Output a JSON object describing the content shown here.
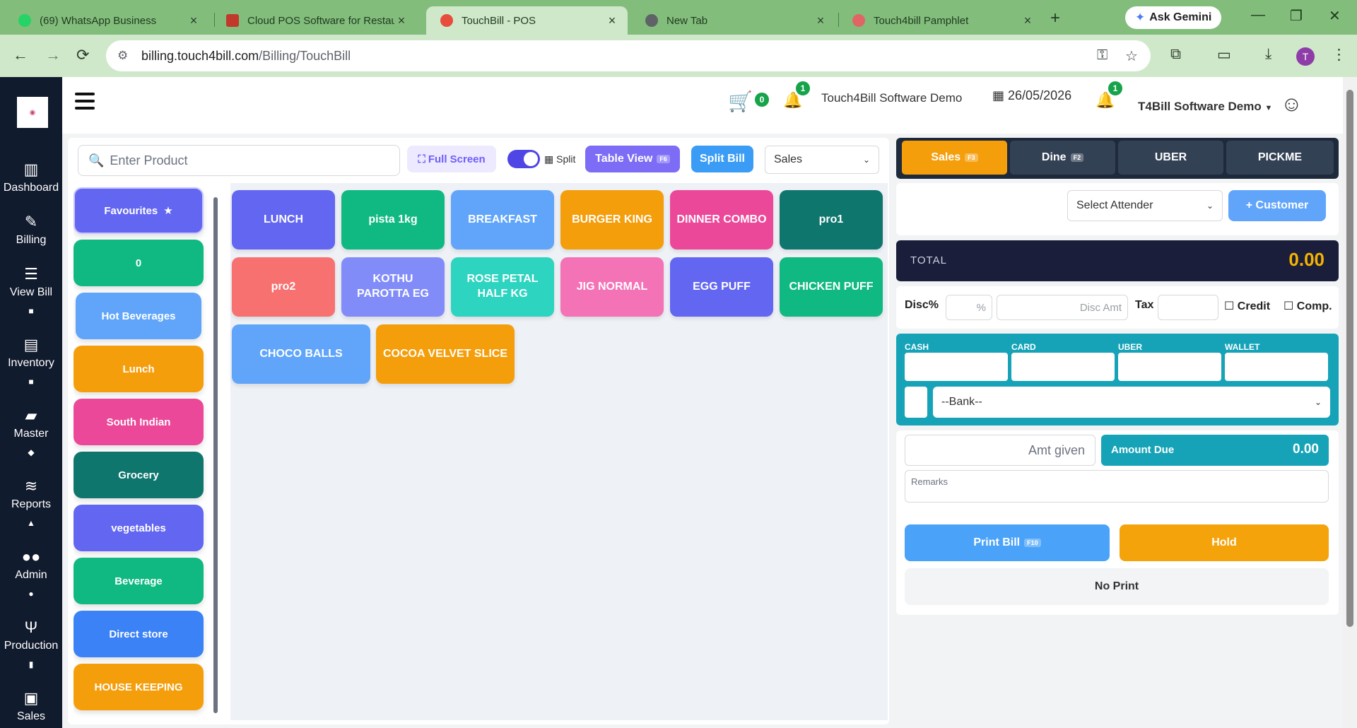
{
  "browser": {
    "tabs": [
      {
        "title": "(69) WhatsApp Business",
        "favicon_color": "#25d366"
      },
      {
        "title": "Cloud POS Software for Restau",
        "favicon_color": "#c0392b"
      },
      {
        "title": "TouchBill - POS",
        "favicon_color": "#e74c3c"
      },
      {
        "title": "New Tab",
        "favicon_color": "#5f6368"
      },
      {
        "title": "Touch4bill Pamphlet",
        "favicon_color": "#e06666"
      }
    ],
    "gemini_label": "Ask Gemini",
    "url_host": "billing.touch4bill.com",
    "url_path": "/Billing/TouchBill",
    "profile_initial": "T"
  },
  "sidebar": {
    "items": [
      {
        "label": "Dashboard",
        "icon": "chart-icon"
      },
      {
        "label": "Billing",
        "icon": "edit-icon"
      },
      {
        "label": "View Bill",
        "icon": "list-icon"
      },
      {
        "label": "Inventory",
        "icon": "box-icon"
      },
      {
        "label": "Master",
        "icon": "folder-icon"
      },
      {
        "label": "Reports",
        "icon": "layers-icon"
      },
      {
        "label": "Admin",
        "icon": "users-icon"
      },
      {
        "label": "Production",
        "icon": "utensils-icon"
      },
      {
        "label": "Sales",
        "icon": "archive-icon"
      }
    ]
  },
  "header": {
    "cart_count": "0",
    "notif_count": "1",
    "company": "Touch4Bill Software Demo",
    "date": "26/05/2026",
    "notif_count_2": "1",
    "user": "T4Bill Software Demo"
  },
  "toolbar": {
    "search_placeholder": "Enter Product",
    "fullscreen": "Full Screen",
    "split": "Split",
    "table_view": "Table View",
    "table_view_key": "F6",
    "split_bill": "Split Bill",
    "mode": "Sales"
  },
  "categories": [
    {
      "label": "Favourites",
      "color": "#6366f1"
    },
    {
      "label": "0",
      "color": "#10b981"
    },
    {
      "label": "Hot Beverages",
      "color": "#60a5fa"
    },
    {
      "label": "Lunch",
      "color": "#f59e0b"
    },
    {
      "label": "South Indian",
      "color": "#ec4899"
    },
    {
      "label": "Grocery",
      "color": "#0f766e"
    },
    {
      "label": "vegetables",
      "color": "#6366f1"
    },
    {
      "label": "Beverage",
      "color": "#10b981"
    },
    {
      "label": "Direct store",
      "color": "#3b82f6"
    },
    {
      "label": "HOUSE KEEPING",
      "color": "#f59e0b"
    }
  ],
  "products": [
    {
      "label": "LUNCH",
      "color": "#6366f1"
    },
    {
      "label": "pista 1kg",
      "color": "#10b981"
    },
    {
      "label": "BREAKFAST",
      "color": "#60a5fa"
    },
    {
      "label": "BURGER KING",
      "color": "#f59e0b"
    },
    {
      "label": "DINNER COMBO",
      "color": "#ec4899"
    },
    {
      "label": "pro1",
      "color": "#0f766e"
    },
    {
      "label": "pro2",
      "color": "#f87171"
    },
    {
      "label": "KOTHU PAROTTA EG",
      "color": "#818cf8"
    },
    {
      "label": "ROSE PETAL HALF KG",
      "color": "#2dd4bf"
    },
    {
      "label": "JIG NORMAL",
      "color": "#f472b6"
    },
    {
      "label": "EGG PUFF",
      "color": "#6366f1"
    },
    {
      "label": "CHICKEN PUFF",
      "color": "#10b981"
    },
    {
      "label": "CHOCO BALLS",
      "color": "#60a5fa"
    },
    {
      "label": "COCOA VELVET SLICE",
      "color": "#f59e0b"
    }
  ],
  "order": {
    "tabs": [
      {
        "label": "Sales",
        "key": "F3"
      },
      {
        "label": "Dine",
        "key": "F2"
      },
      {
        "label": "UBER",
        "key": ""
      },
      {
        "label": "PICKME",
        "key": ""
      }
    ],
    "attender_placeholder": "Select Attender",
    "customer_button": "+ Customer",
    "total_label": "TOTAL",
    "total_value": "0.00",
    "disc_label": "Disc%",
    "disc_pct": "%",
    "disc_amt_placeholder": "Disc Amt",
    "tax_label": "Tax",
    "credit_label": "Credit",
    "comp_label": "Comp.",
    "pay_labels": [
      "CASH",
      "CARD",
      "UBER",
      "WALLET"
    ],
    "bank_placeholder": "--Bank--",
    "amt_given_placeholder": "Amt given",
    "amount_due_label": "Amount Due",
    "amount_due_value": "0.00",
    "remarks_placeholder": "Remarks",
    "print_bill": "Print Bill",
    "print_key": "F10",
    "hold": "Hold",
    "no_print": "No Print"
  }
}
